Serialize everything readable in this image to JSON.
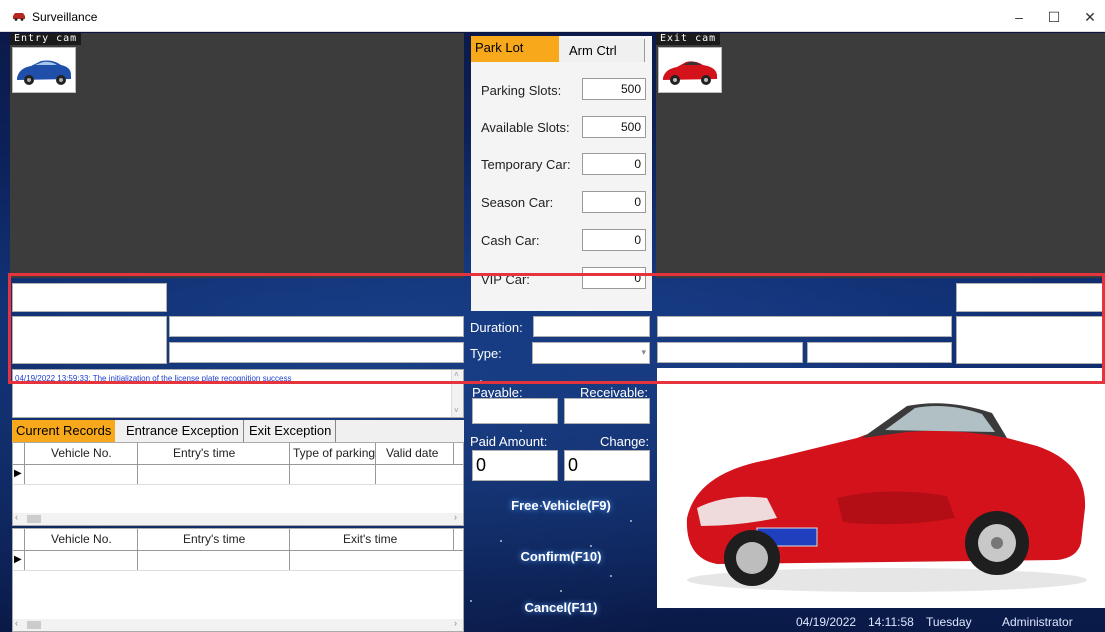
{
  "window": {
    "title": "Surveillance",
    "minimize": "–",
    "maximize": "☐",
    "close": "✕"
  },
  "entry_cam": {
    "label": "Entry cam"
  },
  "exit_cam": {
    "label": "Exit cam"
  },
  "lot_panel": {
    "tabs": {
      "park_lot": "Park Lot",
      "arm_ctrl": "Arm Ctrl"
    },
    "stats": [
      {
        "label": "Parking Slots:",
        "value": "500"
      },
      {
        "label": "Available Slots:",
        "value": "500"
      },
      {
        "label": "Temporary Car:",
        "value": "0"
      },
      {
        "label": "Season Car:",
        "value": "0"
      },
      {
        "label": "Cash Car:",
        "value": "0"
      },
      {
        "label": "VIP Car:",
        "value": "0"
      }
    ]
  },
  "charge": {
    "duration_label": "Duration:",
    "type_label": "Type:",
    "payable_label": "Payable:",
    "receivable_label": "Receivable:",
    "paid_label": "Paid Amount:",
    "change_label": "Change:",
    "paid_value": "0",
    "change_value": "0"
  },
  "log": {
    "message": "04/19/2022 13:59:33: The initialization of the license plate recognition success"
  },
  "records": {
    "tabs": [
      "Current Records",
      "Entrance Exception",
      "Exit Exception"
    ],
    "entry_columns": [
      "Vehicle No.",
      "Entry's time",
      "Type of parking",
      "Valid date"
    ],
    "exit_columns": [
      "Vehicle No.",
      "Entry's time",
      "Exit's time"
    ]
  },
  "actions": {
    "free_vehicle": "Free Vehicle(F9)",
    "confirm": "Confirm(F10)",
    "cancel": "Cancel(F11)"
  },
  "status_bar": {
    "date": "04/19/2022",
    "time": "14:11:58",
    "weekday": "Tuesday",
    "user": "Administrator"
  },
  "colors": {
    "active_tab": "#f7a81b",
    "highlight_box": "#e6343f",
    "camera_bg": "#3c3c3c",
    "log_text": "#1f3fd0"
  }
}
